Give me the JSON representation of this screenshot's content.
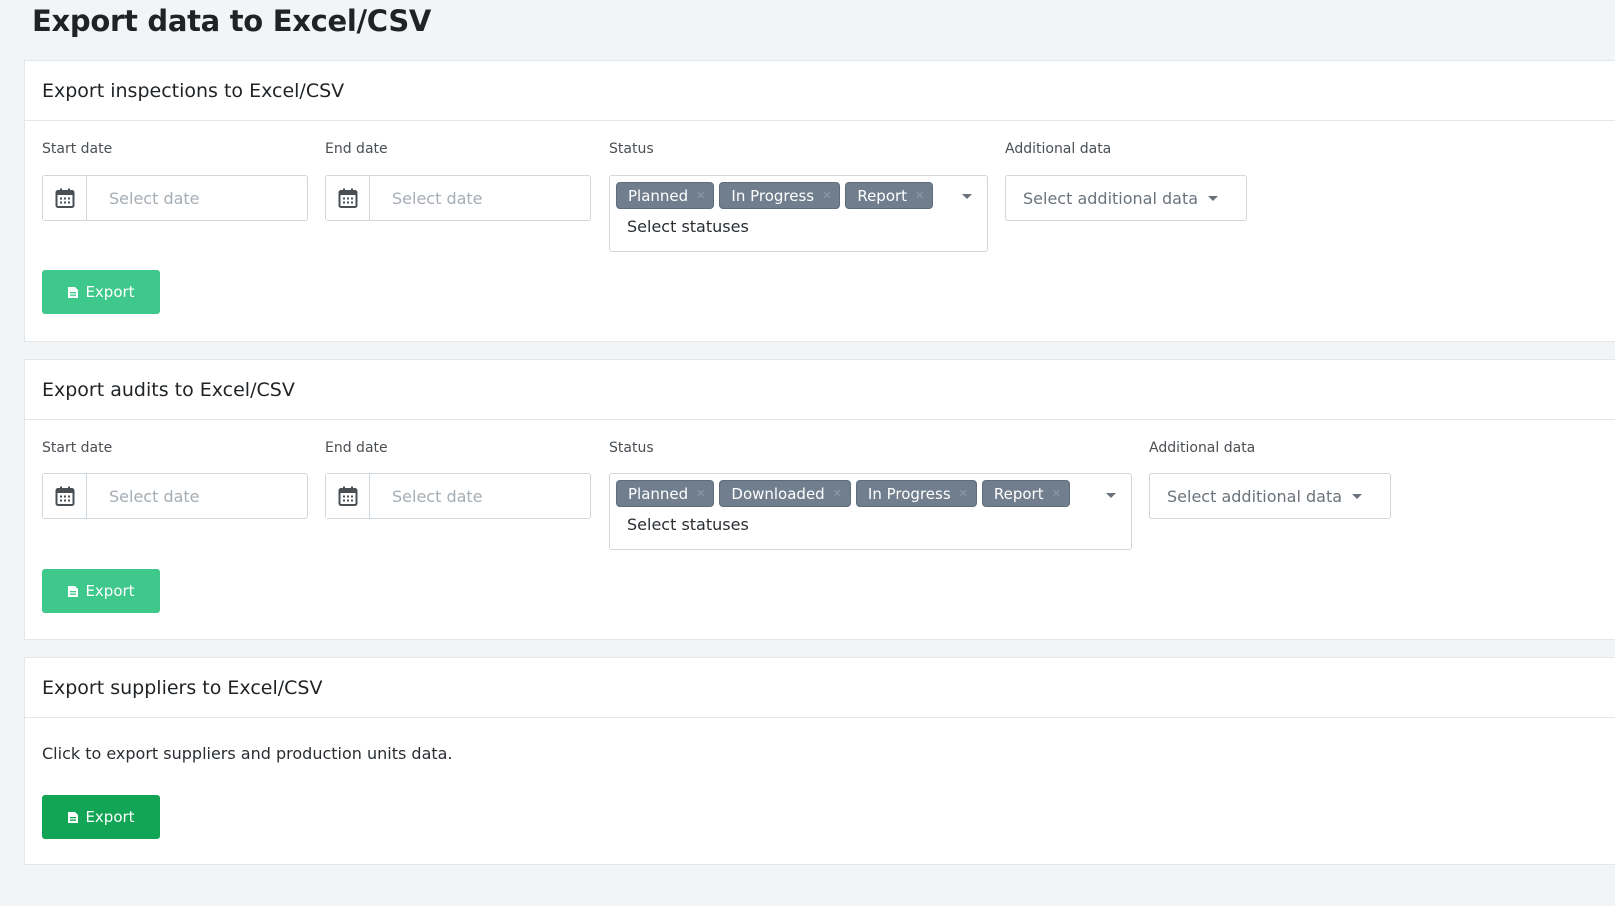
{
  "page": {
    "title": "Export data to Excel/CSV"
  },
  "colors": {
    "button_active": "#12a556",
    "button_inactive": "#3ec88b",
    "tag": "#707e8d"
  },
  "inspections": {
    "title": "Export inspections to Excel/CSV",
    "start_label": "Start date",
    "start_placeholder": "Select date",
    "end_label": "End date",
    "end_placeholder": "Select date",
    "status_label": "Status",
    "statuses": [
      "Planned",
      "In Progress",
      "Report"
    ],
    "status_placeholder": "Select statuses",
    "additional_label": "Additional data",
    "additional_placeholder": "Select additional data",
    "export_label": "Export"
  },
  "audits": {
    "title": "Export audits to Excel/CSV",
    "start_label": "Start date",
    "start_placeholder": "Select date",
    "end_label": "End date",
    "end_placeholder": "Select date",
    "status_label": "Status",
    "statuses": [
      "Planned",
      "Downloaded",
      "In Progress",
      "Report"
    ],
    "status_placeholder": "Select statuses",
    "additional_label": "Additional data",
    "additional_placeholder": "Select additional data",
    "export_label": "Export"
  },
  "suppliers": {
    "title": "Export suppliers to Excel/CSV",
    "description": "Click to export suppliers and production units data.",
    "export_label": "Export"
  },
  "icons": {
    "date": "calendar-icon",
    "export": "file-icon",
    "dropdown": "caret-down-icon",
    "remove": "close-icon"
  }
}
